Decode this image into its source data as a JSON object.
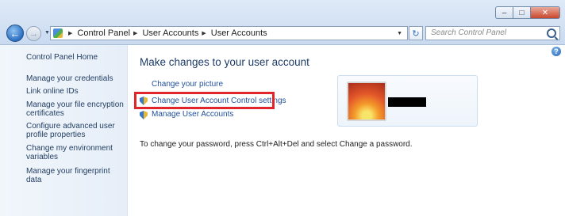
{
  "window": {
    "caption_buttons": [
      "minimize",
      "maximize",
      "close"
    ]
  },
  "address_bar": {
    "breadcrumbs": [
      "Control Panel",
      "User Accounts",
      "User Accounts"
    ]
  },
  "search": {
    "placeholder": "Search Control Panel"
  },
  "left_pane": {
    "items": [
      "Control Panel Home",
      "Manage your credentials",
      "Link online IDs",
      "Manage your file encryption certificates",
      "Configure advanced user profile properties",
      "Change my environment variables",
      "Manage your fingerprint data"
    ]
  },
  "main": {
    "title": "Make changes to your user account",
    "tasks": {
      "change_picture": "Change your picture",
      "uac_settings": "Change User Account Control settings",
      "manage_accounts": "Manage User Accounts"
    },
    "info": "To change your password, press Ctrl+Alt+Del and select Change a password."
  },
  "user_tile": {
    "username": ""
  },
  "colors": {
    "highlight": "#e0252b",
    "link": "#1f4f9c",
    "title": "#1e3b67"
  }
}
